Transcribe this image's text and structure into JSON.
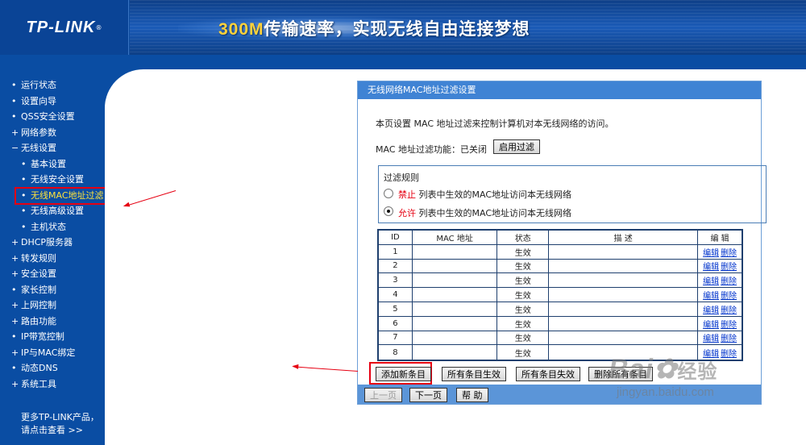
{
  "header": {
    "logo": "TP-LINK",
    "logo_mark": "®",
    "slogan_number": "300M",
    "slogan_text": "传输速率，实现无线自由连接梦想"
  },
  "sidebar": {
    "items": [
      {
        "label": "运行状态",
        "bullet": "•"
      },
      {
        "label": "设置向导",
        "bullet": "•"
      },
      {
        "label": "QSS安全设置",
        "bullet": "•"
      },
      {
        "label": "网络参数",
        "bullet": "+"
      },
      {
        "label": "无线设置",
        "bullet": "−"
      },
      {
        "label": "基本设置",
        "bullet": "•"
      },
      {
        "label": "无线安全设置",
        "bullet": "•"
      },
      {
        "label": "无线MAC地址过滤",
        "bullet": "•"
      },
      {
        "label": "无线高级设置",
        "bullet": "•"
      },
      {
        "label": "主机状态",
        "bullet": "•"
      },
      {
        "label": "DHCP服务器",
        "bullet": "+"
      },
      {
        "label": "转发规则",
        "bullet": "+"
      },
      {
        "label": "安全设置",
        "bullet": "+"
      },
      {
        "label": "家长控制",
        "bullet": "•"
      },
      {
        "label": "上网控制",
        "bullet": "+"
      },
      {
        "label": "路由功能",
        "bullet": "+"
      },
      {
        "label": "IP带宽控制",
        "bullet": "•"
      },
      {
        "label": "IP与MAC绑定",
        "bullet": "+"
      },
      {
        "label": "动态DNS",
        "bullet": "•"
      },
      {
        "label": "系统工具",
        "bullet": "+"
      }
    ],
    "footer_line1": "更多TP-LINK产品，",
    "footer_line2": "请点击查看 >>"
  },
  "panel": {
    "title": "无线网络MAC地址过滤设置",
    "description": "本页设置 MAC 地址过滤来控制计算机对本无线网络的访问。",
    "status_label": "MAC 地址过滤功能：已关闭",
    "enable_button": "启用过滤",
    "rules": {
      "title": "过滤规则",
      "deny_keyword": "禁止",
      "deny_text": "列表中生效的MAC地址访问本无线网络",
      "allow_keyword": "允许",
      "allow_text": "列表中生效的MAC地址访问本无线网络",
      "selected": "allow"
    },
    "table": {
      "headers": [
        "ID",
        "MAC 地址",
        "状态",
        "描 述",
        "编 辑"
      ],
      "rows": [
        {
          "id": "1",
          "status": "生效",
          "edit": "编辑",
          "delete": "删除"
        },
        {
          "id": "2",
          "status": "生效",
          "edit": "编辑",
          "delete": "删除"
        },
        {
          "id": "3",
          "status": "生效",
          "edit": "编辑",
          "delete": "删除"
        },
        {
          "id": "4",
          "status": "生效",
          "edit": "编辑",
          "delete": "删除"
        },
        {
          "id": "5",
          "status": "生效",
          "edit": "编辑",
          "delete": "删除"
        },
        {
          "id": "6",
          "status": "生效",
          "edit": "编辑",
          "delete": "删除"
        },
        {
          "id": "7",
          "status": "生效",
          "edit": "编辑",
          "delete": "删除"
        },
        {
          "id": "8",
          "status": "生效",
          "edit": "编辑",
          "delete": "删除"
        }
      ]
    },
    "actions": {
      "add": "添加新条目",
      "enable_all": "所有条目生效",
      "disable_all": "所有条目失效",
      "delete_all": "删除所有条目"
    },
    "nav": {
      "prev": "上一页",
      "next": "下一页",
      "help": "帮 助"
    }
  },
  "watermark": {
    "brand": "Bai",
    "brand_cn": "经验",
    "url": "jingyan.baidu.com"
  },
  "colors": {
    "brand_blue": "#0a4da3",
    "title_bar": "#3f83d4",
    "highlight_red": "#e60012",
    "active_menu": "#ffe23b"
  }
}
